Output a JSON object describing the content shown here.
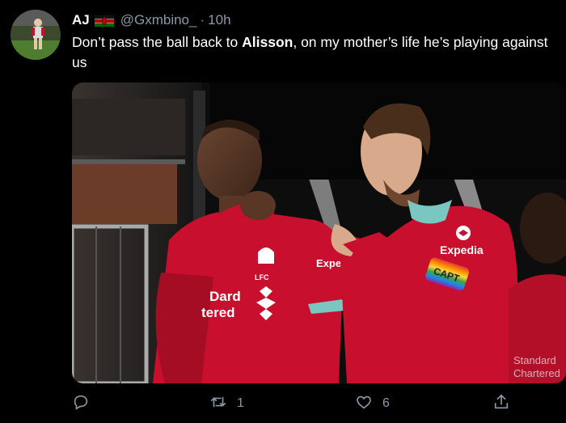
{
  "tweet": {
    "author": {
      "display_name": "AJ",
      "flag_icon": "kenya-flag-icon",
      "handle": "@Gxmbino_",
      "separator": "·",
      "time": "10h"
    },
    "text_before": "Don’t pass the ball back to ",
    "text_bold": "Alisson",
    "text_after": ", on my mother’s life he’s playing against us",
    "media": {
      "sponsor_left": "Expe",
      "sponsor_right": "Expedia",
      "shirt_text_1": "Dard",
      "shirt_text_2": "tered",
      "crest_text": "LFC",
      "armband_text": "CAPT",
      "bg_shirt_1": "Standard",
      "bg_shirt_2": "Chartered"
    },
    "actions": {
      "reply_icon": "reply-icon",
      "retweet_icon": "retweet-icon",
      "retweet_count": "1",
      "like_icon": "heart-icon",
      "like_count": "6",
      "share_icon": "share-icon"
    }
  },
  "colors": {
    "background": "#000000",
    "secondary_text": "#8b98a5",
    "liverpool_red": "#c8102e"
  }
}
